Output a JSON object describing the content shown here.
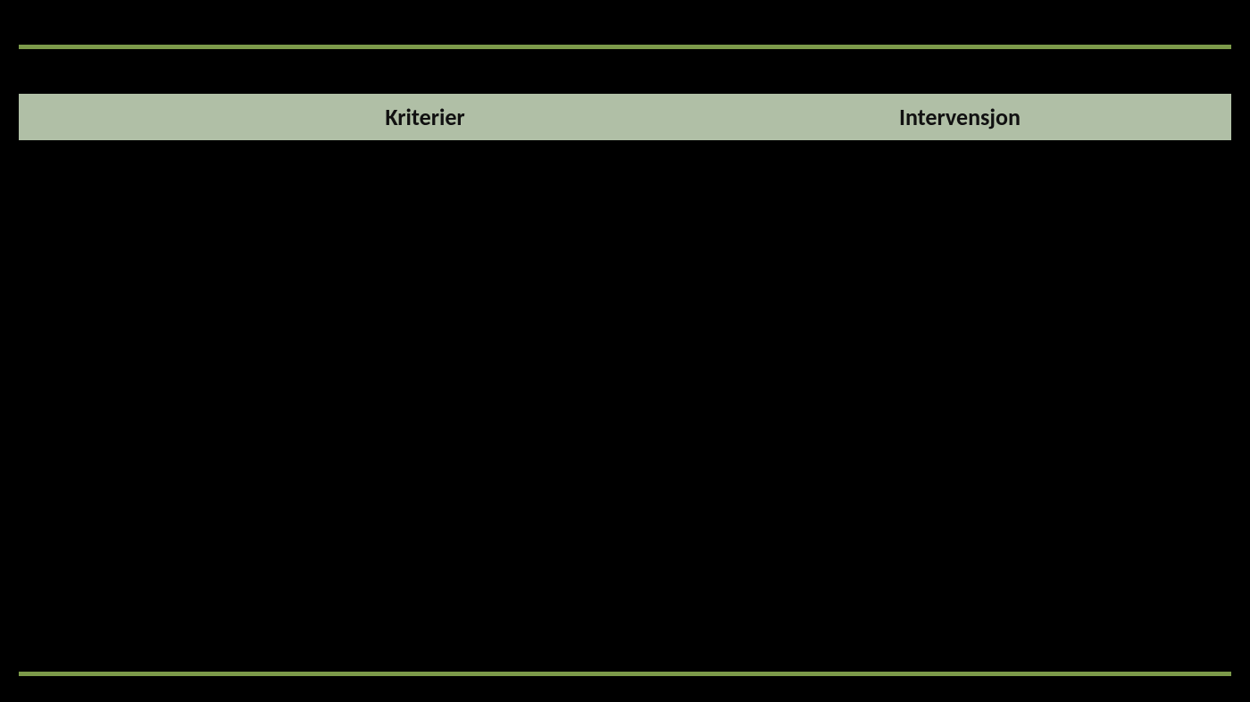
{
  "table": {
    "headers": {
      "kriterier": "Kriterier",
      "intervensjon": "Intervensjon"
    }
  }
}
